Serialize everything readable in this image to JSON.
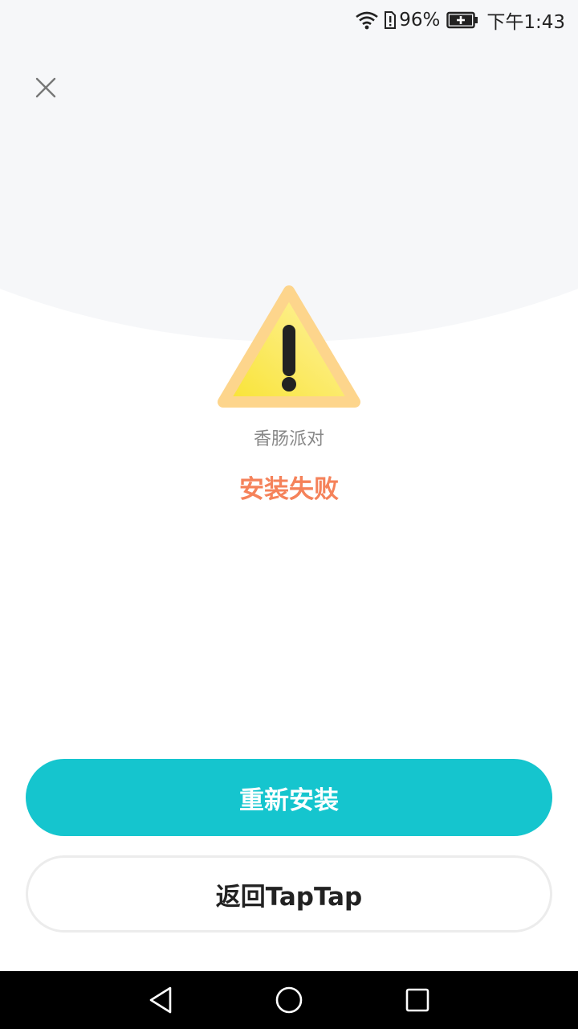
{
  "status_bar": {
    "wifi_icon": "wifi-icon",
    "sim_icon": "sim-alert-icon",
    "battery_percent": "96%",
    "battery_icon": "battery-charging-icon",
    "time": "下午1:43"
  },
  "header": {
    "close_icon": "close-icon"
  },
  "main": {
    "warning_icon": "warning-triangle-icon",
    "app_name": "香肠派对",
    "status": "安装失败"
  },
  "actions": {
    "reinstall_label": "重新安装",
    "back_label": "返回TapTap"
  },
  "nav": {
    "back_icon": "nav-back-icon",
    "home_icon": "nav-home-icon",
    "recents_icon": "nav-recents-icon"
  },
  "colors": {
    "primary": "#15c5ce",
    "status_error": "#f5825a",
    "background_top": "#f6f7f9",
    "warning_yellow": "#fbe24a"
  }
}
